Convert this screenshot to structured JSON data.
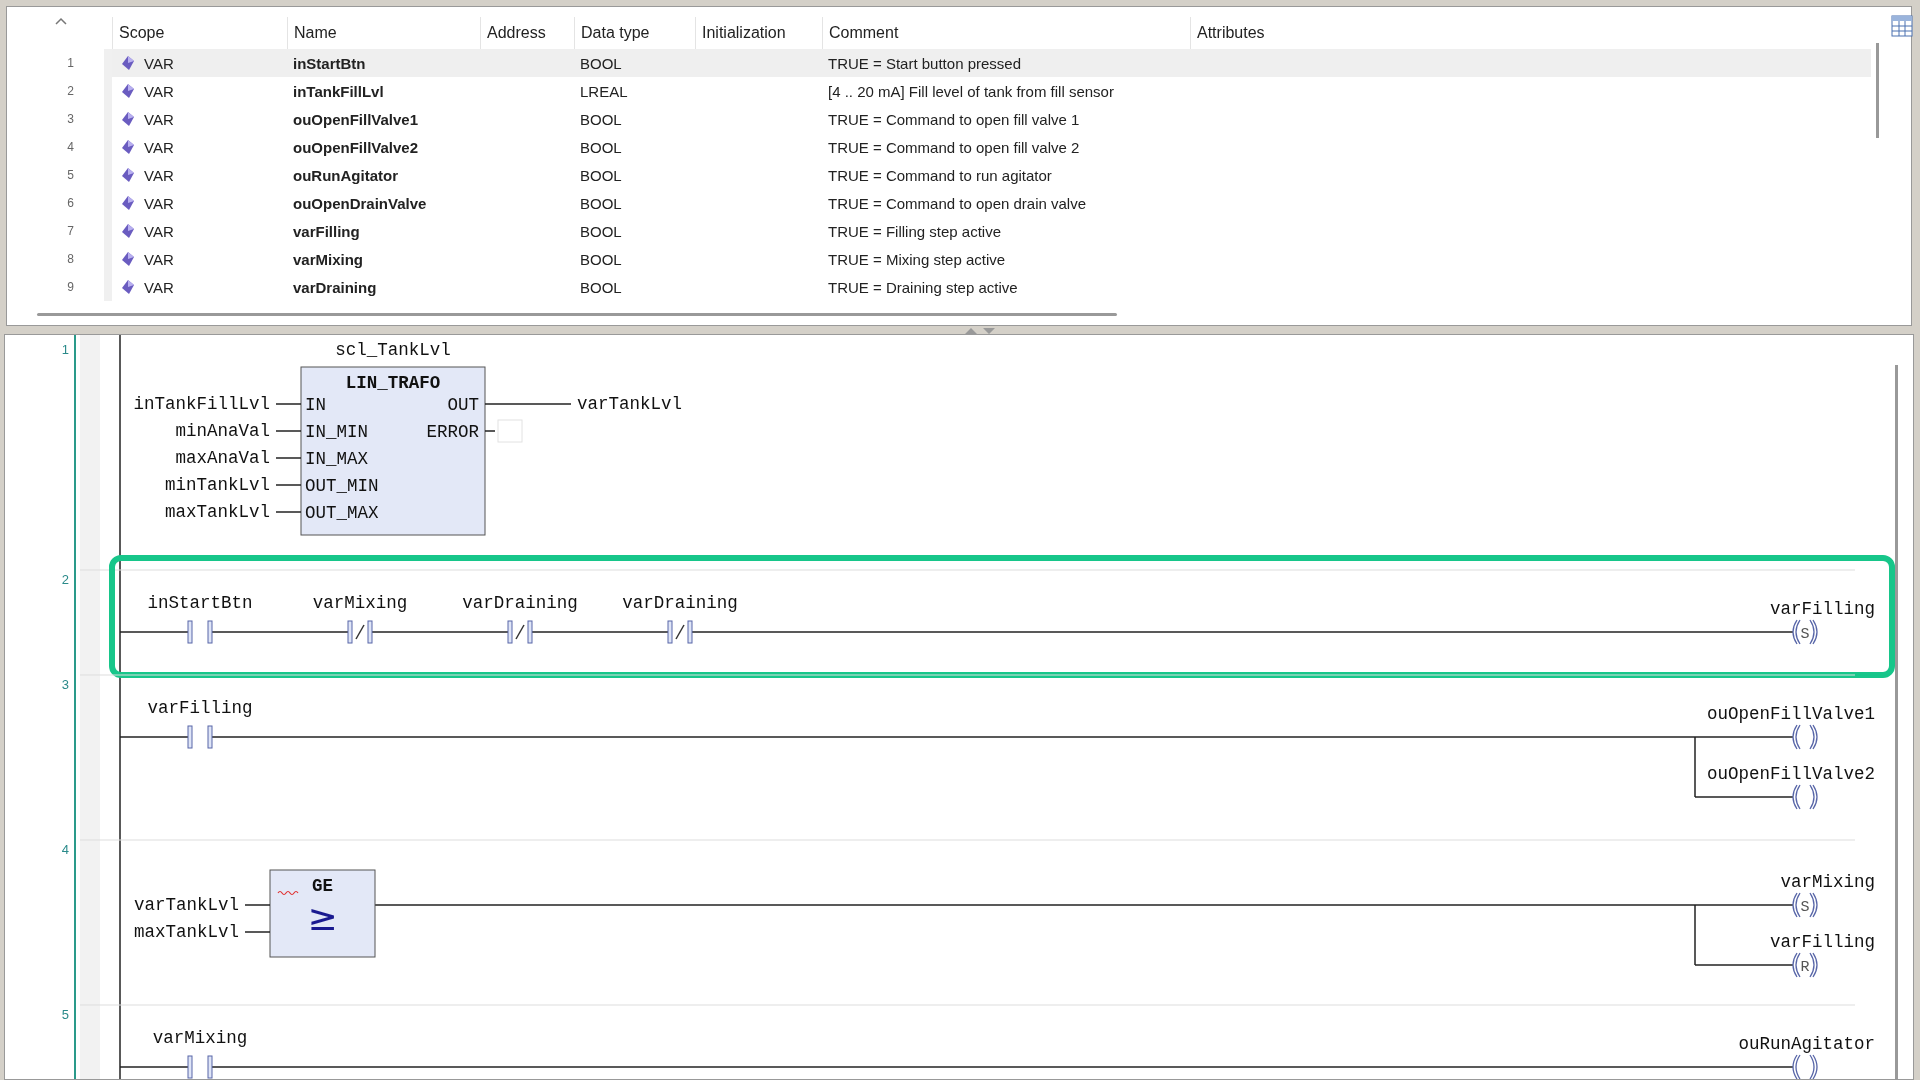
{
  "table": {
    "columns": [
      "Scope",
      "Name",
      "Address",
      "Data type",
      "Initialization",
      "Comment",
      "Attributes"
    ],
    "rows": [
      {
        "number": "1",
        "scope": "VAR",
        "name": "inStartBtn",
        "data_type": "BOOL",
        "comment": "TRUE = Start button pressed",
        "selected": true
      },
      {
        "number": "2",
        "scope": "VAR",
        "name": "inTankFillLvl",
        "data_type": "LREAL",
        "comment": "[4 .. 20 mA] Fill level of tank from fill sensor",
        "selected": false
      },
      {
        "number": "3",
        "scope": "VAR",
        "name": "ouOpenFillValve1",
        "data_type": "BOOL",
        "comment": "TRUE = Command to open fill valve 1",
        "selected": false
      },
      {
        "number": "4",
        "scope": "VAR",
        "name": "ouOpenFillValve2",
        "data_type": "BOOL",
        "comment": "TRUE = Command to open fill valve 2",
        "selected": false
      },
      {
        "number": "5",
        "scope": "VAR",
        "name": "ouRunAgitator",
        "data_type": "BOOL",
        "comment": "TRUE = Command to run agitator",
        "selected": false
      },
      {
        "number": "6",
        "scope": "VAR",
        "name": "ouOpenDrainValve",
        "data_type": "BOOL",
        "comment": "TRUE = Command to open drain valve",
        "selected": false
      },
      {
        "number": "7",
        "scope": "VAR",
        "name": "varFilling",
        "data_type": "BOOL",
        "comment": "TRUE = Filling step active",
        "selected": false
      },
      {
        "number": "8",
        "scope": "VAR",
        "name": "varMixing",
        "data_type": "BOOL",
        "comment": "TRUE = Mixing step active",
        "selected": false
      },
      {
        "number": "9",
        "scope": "VAR",
        "name": "varDraining",
        "data_type": "BOOL",
        "comment": "TRUE = Draining step active",
        "selected": false
      }
    ]
  },
  "ladder": {
    "networks": [
      {
        "number": "1",
        "highlighted": false,
        "box": {
          "instance": "scl_TankLvl",
          "type": "LIN_TRAFO",
          "inputs": [
            {
              "pin": "IN",
              "variable": "inTankFillLvl"
            },
            {
              "pin": "IN_MIN",
              "variable": "minAnaVal"
            },
            {
              "pin": "IN_MAX",
              "variable": "maxAnaVal"
            },
            {
              "pin": "OUT_MIN",
              "variable": "minTankLvl"
            },
            {
              "pin": "OUT_MAX",
              "variable": "maxTankLvl"
            }
          ],
          "outputs": [
            {
              "pin": "OUT",
              "variable": "varTankLvl"
            },
            {
              "pin": "ERROR"
            }
          ]
        }
      },
      {
        "number": "2",
        "highlighted": true,
        "contacts": [
          {
            "variable": "inStartBtn",
            "negated": false
          },
          {
            "variable": "varMixing",
            "negated": true
          },
          {
            "variable": "varDraining",
            "negated": true
          },
          {
            "variable": "varDraining",
            "negated": true
          }
        ],
        "coils": [
          {
            "variable": "varFilling",
            "symbol": "S"
          }
        ]
      },
      {
        "number": "3",
        "highlighted": false,
        "contacts": [
          {
            "variable": "varFilling",
            "negated": false
          }
        ],
        "coils": [
          {
            "variable": "ouOpenFillValve1"
          },
          {
            "variable": "ouOpenFillValve2"
          }
        ]
      },
      {
        "number": "4",
        "highlighted": false,
        "box": {
          "type": "GE",
          "symbol": "≥",
          "inputs": [
            {
              "variable": "varTankLvl"
            },
            {
              "variable": "maxTankLvl"
            }
          ]
        },
        "coils": [
          {
            "variable": "varMixing",
            "symbol": "S"
          },
          {
            "variable": "varFilling",
            "symbol": "R"
          }
        ]
      },
      {
        "number": "5",
        "highlighted": false,
        "contacts": [
          {
            "variable": "varMixing",
            "negated": false
          }
        ],
        "coils": [
          {
            "variable": "ouRunAgitator"
          }
        ]
      }
    ]
  }
}
